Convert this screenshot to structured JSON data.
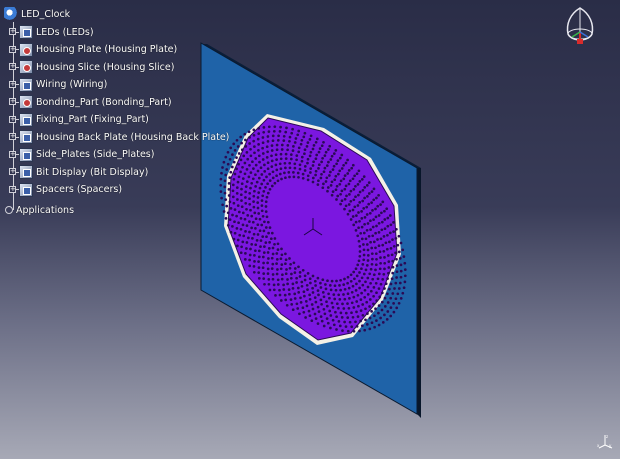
{
  "tree": {
    "root": {
      "label": "LED_Clock",
      "icon": "product-icon"
    },
    "items": [
      {
        "label": "LEDs (LEDs)",
        "icon": "part-icon"
      },
      {
        "label": "Housing Plate (Housing Plate)",
        "icon": "part-gear-icon"
      },
      {
        "label": "Housing Slice (Housing Slice)",
        "icon": "part-gear-icon"
      },
      {
        "label": "Wiring (Wiring)",
        "icon": "part-icon"
      },
      {
        "label": "Bonding_Part (Bonding_Part)",
        "icon": "part-gear-icon"
      },
      {
        "label": "Fixing_Part (Fixing_Part)",
        "icon": "part-icon"
      },
      {
        "label": "Housing Back Plate (Housing Back Plate)",
        "icon": "part-icon"
      },
      {
        "label": "Side_Plates (Side_Plates)",
        "icon": "part-icon"
      },
      {
        "label": "Bit Display (Bit Display)",
        "icon": "part-icon"
      },
      {
        "label": "Spacers (Spacers)",
        "icon": "part-icon"
      }
    ],
    "applications": {
      "label": "Applications",
      "icon": "applications-icon"
    }
  },
  "colors": {
    "plate": "#1f63a8",
    "plate_edge": "#0a1a30",
    "face": "#7b17e0",
    "rim": "#f4f1e6",
    "dots": "#2a0a55"
  },
  "icons": {
    "compass": "compass-icon",
    "axis": "axis-triad-icon"
  }
}
